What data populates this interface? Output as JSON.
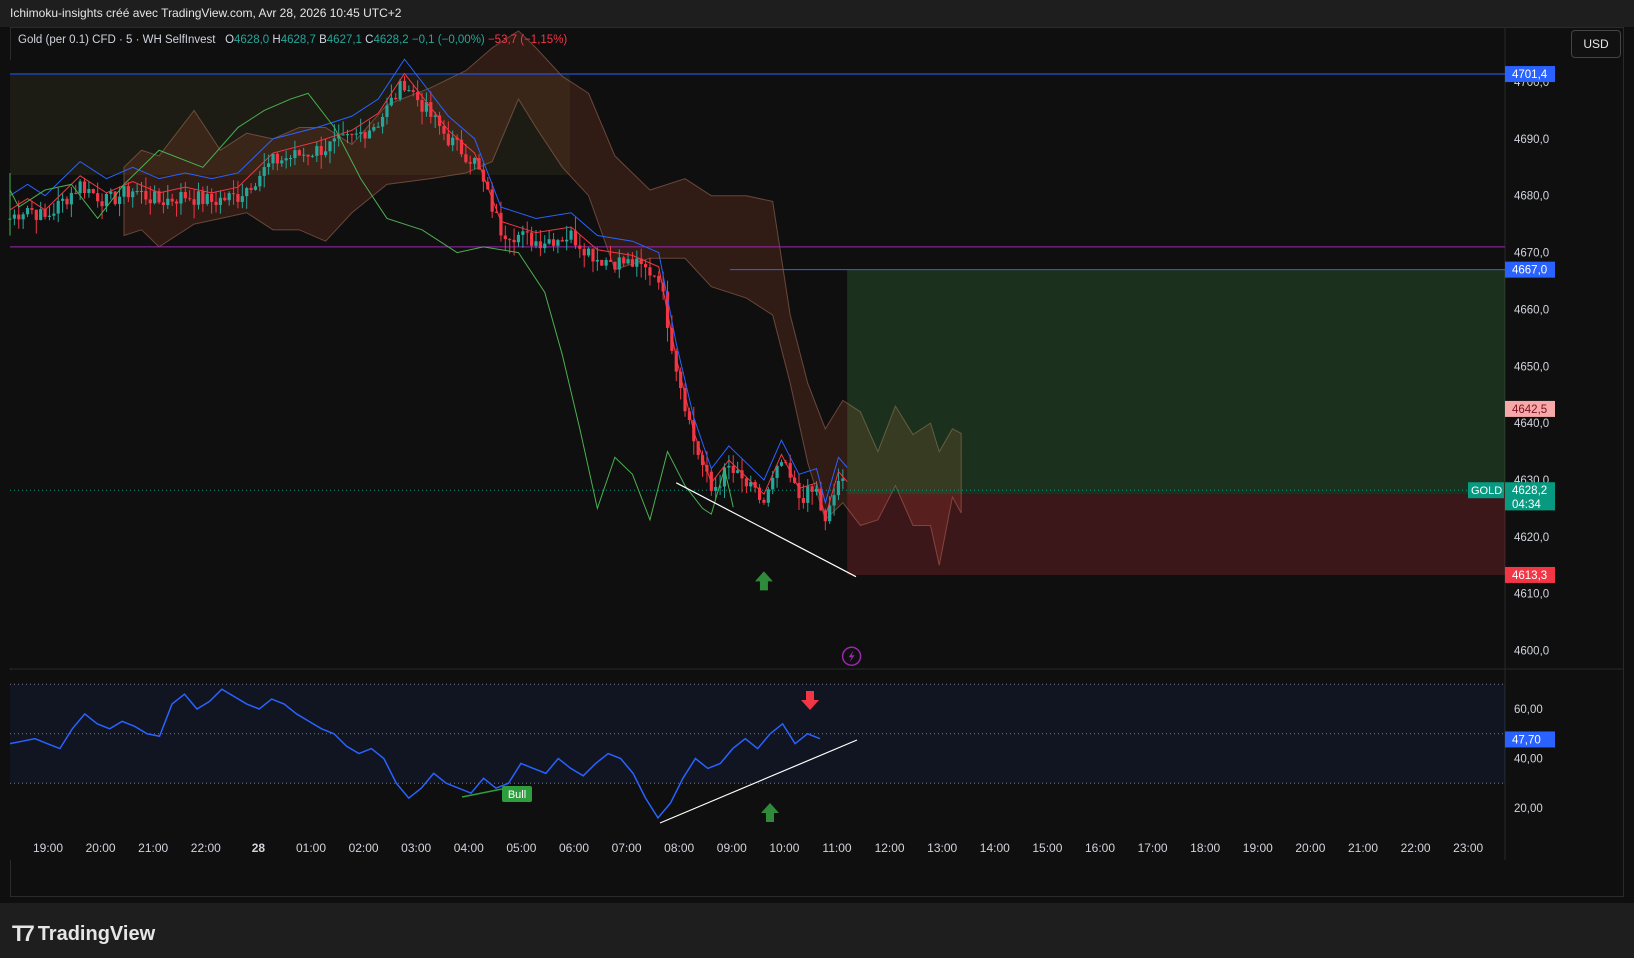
{
  "header": {
    "title": "Ichimoku-insights créé avec TradingView.com, Avr 28, 2026 10:45 UTC+2"
  },
  "legend": {
    "symbol": "Gold (per 0.1) CFD · 5 · WH SelfInvest",
    "o_label": "O",
    "o_value": "4628,0",
    "h_label": "H",
    "h_value": "4628,7",
    "b_label": "B",
    "b_value": "4627,1",
    "c_label": "C",
    "c_value": "4628,2",
    "change": "−0,1 (−0,00%)",
    "change2": "−53,7 (−1,15%)"
  },
  "currency_button": "USD",
  "footer": {
    "brand": "TradingView"
  },
  "colors": {
    "bull": "#26a69a",
    "bear": "#f23645",
    "tenkan": "#f23645",
    "kijun": "#2962ff",
    "chikou": "#4caf50",
    "rsi": "#2962ff",
    "hline_blue": "#2962ff",
    "hline_purple": "#9c27b0"
  },
  "chart_data": [
    {
      "type": "candlestick",
      "title": "Gold (per 0.1) CFD · 5 · WH SelfInvest",
      "indicators": [
        "Ichimoku Cloud"
      ],
      "y_axis": {
        "side": "right",
        "ticks": [
          "4600,0",
          "4610,0",
          "4620,0",
          "4630,0",
          "4640,0",
          "4650,0",
          "4660,0",
          "4670,0",
          "4680,0",
          "4690,0",
          "4700,0"
        ],
        "ylim": [
          4596,
          4704
        ]
      },
      "x_axis": {
        "ticks": [
          "19:00",
          "20:00",
          "21:00",
          "22:00",
          "28",
          "01:00",
          "02:00",
          "03:00",
          "04:00",
          "05:00",
          "06:00",
          "07:00",
          "08:00",
          "09:00",
          "10:00",
          "11:00",
          "12:00",
          "13:00",
          "14:00",
          "15:00",
          "16:00",
          "17:00",
          "18:00",
          "19:00",
          "20:00",
          "21:00",
          "22:00",
          "23:00"
        ]
      },
      "price_labels": [
        {
          "text": "4701,4",
          "value": 4701.4,
          "color": "#2962ff"
        },
        {
          "text": "4667,0",
          "value": 4667.0,
          "color": "#2962ff"
        },
        {
          "text": "4642,5",
          "value": 4642.5,
          "color": "#f7a8a8"
        },
        {
          "text": "4628,2",
          "value": 4628.2,
          "color": "#089981"
        },
        {
          "text": "04:34",
          "value": 4625.8,
          "color": "#089981"
        },
        {
          "text": "4613,3",
          "value": 4613.3,
          "color": "#f23645"
        }
      ],
      "symbol_tag": "GOLD",
      "horizontal_lines": [
        {
          "value": 4701.4,
          "color": "#2962ff"
        },
        {
          "value": 4671.0,
          "color": "#9c27b0"
        }
      ],
      "position_tool": {
        "entry": 4627.5,
        "target": 4667.0,
        "stop": 4613.3,
        "start_time": "10:35"
      },
      "close_series_hourly": [
        {
          "t": "18:40",
          "p": 4676
        },
        {
          "t": "19:00",
          "p": 4678
        },
        {
          "t": "19:20",
          "p": 4676
        },
        {
          "t": "19:40",
          "p": 4679
        },
        {
          "t": "20:00",
          "p": 4682
        },
        {
          "t": "20:30",
          "p": 4679
        },
        {
          "t": "21:00",
          "p": 4681
        },
        {
          "t": "21:30",
          "p": 4679
        },
        {
          "t": "22:00",
          "p": 4680
        },
        {
          "t": "22:30",
          "p": 4679
        },
        {
          "t": "23:00",
          "p": 4680
        },
        {
          "t": "23:40",
          "p": 4686
        },
        {
          "t": "00:30",
          "p": 4688
        },
        {
          "t": "01:10",
          "p": 4690
        },
        {
          "t": "01:40",
          "p": 4693
        },
        {
          "t": "02:10",
          "p": 4700
        },
        {
          "t": "02:30",
          "p": 4696
        },
        {
          "t": "03:00",
          "p": 4690
        },
        {
          "t": "03:30",
          "p": 4686
        },
        {
          "t": "04:00",
          "p": 4674
        },
        {
          "t": "04:40",
          "p": 4672
        },
        {
          "t": "05:20",
          "p": 4673
        },
        {
          "t": "05:50",
          "p": 4669
        },
        {
          "t": "06:30",
          "p": 4668
        },
        {
          "t": "07:00",
          "p": 4666
        },
        {
          "t": "07:20",
          "p": 4650
        },
        {
          "t": "07:40",
          "p": 4637
        },
        {
          "t": "08:00",
          "p": 4628
        },
        {
          "t": "08:20",
          "p": 4632
        },
        {
          "t": "08:40",
          "p": 4629
        },
        {
          "t": "09:00",
          "p": 4626
        },
        {
          "t": "09:20",
          "p": 4633
        },
        {
          "t": "09:40",
          "p": 4627
        },
        {
          "t": "10:00",
          "p": 4628
        },
        {
          "t": "10:10",
          "p": 4622
        },
        {
          "t": "10:25",
          "p": 4630
        },
        {
          "t": "10:35",
          "p": 4628.2
        }
      ],
      "annotations": [
        {
          "type": "trendline",
          "from": {
            "t": "07:20",
            "p": 4629.5
          },
          "to": {
            "t": "10:45",
            "p": 4613
          },
          "color": "#ffffff"
        },
        {
          "type": "arrow-up",
          "t": "09:00",
          "p": 4612,
          "color": "#2e8b3a"
        },
        {
          "type": "event-icon",
          "t": "10:40",
          "p": 4599,
          "color": "#9c27b0"
        }
      ]
    },
    {
      "type": "line",
      "title": "RSI",
      "series": [
        {
          "values": [
            46,
            47,
            48,
            46,
            44,
            52,
            58,
            54,
            52,
            55,
            53,
            50,
            49,
            62,
            66,
            60,
            63,
            68,
            65,
            62,
            60,
            64,
            62,
            58,
            55,
            52,
            50,
            45,
            42,
            44,
            40,
            30,
            24,
            28,
            34,
            30,
            28,
            26,
            32,
            28,
            30,
            38,
            36,
            34,
            40,
            36,
            33,
            38,
            42,
            40,
            34,
            24,
            16,
            22,
            32,
            40,
            36,
            38,
            44,
            48,
            44,
            50,
            54,
            46,
            50,
            48
          ]
        }
      ],
      "current_value": "47,70",
      "levels": [
        70,
        50,
        30
      ],
      "y_axis": {
        "ticks": [
          "20,00",
          "40,00",
          "60,00"
        ],
        "ylim": [
          15,
          75
        ]
      },
      "annotations": [
        {
          "type": "label",
          "text": "Bull",
          "color": "#2e9d3e"
        },
        {
          "type": "trendline",
          "color": "#ffffff"
        },
        {
          "type": "arrow-up",
          "color": "#2e8b3a"
        },
        {
          "type": "arrow-down",
          "color": "#f23645"
        }
      ]
    }
  ]
}
